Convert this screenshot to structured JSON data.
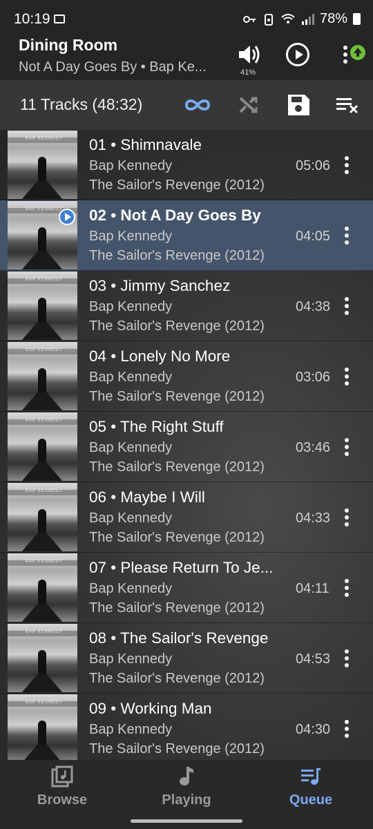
{
  "status_bar": {
    "time": "10:19",
    "battery": "78%"
  },
  "header": {
    "room": "Dining Room",
    "now_playing": "Not A Day Goes By • Bap Ke...",
    "volume_percent": "41%"
  },
  "toolbar": {
    "track_summary": "11 Tracks (48:32)"
  },
  "colors": {
    "accent": "#7aa9f0",
    "active_row": "#44546a",
    "badge": "#6fbf3a"
  },
  "tracks": [
    {
      "title": "01 • Shimnavale",
      "artist": "Bap Kennedy",
      "album": "The Sailor's Revenge (2012)",
      "duration": "05:06"
    },
    {
      "title": "02 • Not A Day Goes By",
      "artist": "Bap Kennedy",
      "album": "The Sailor's Revenge (2012)",
      "duration": "04:05"
    },
    {
      "title": "03 • Jimmy Sanchez",
      "artist": "Bap Kennedy",
      "album": "The Sailor's Revenge (2012)",
      "duration": "04:38"
    },
    {
      "title": "04 • Lonely No More",
      "artist": "Bap Kennedy",
      "album": "The Sailor's Revenge (2012)",
      "duration": "03:06"
    },
    {
      "title": "05 • The Right Stuff",
      "artist": "Bap Kennedy",
      "album": "The Sailor's Revenge (2012)",
      "duration": "03:46"
    },
    {
      "title": "06 • Maybe I Will",
      "artist": "Bap Kennedy",
      "album": "The Sailor's Revenge (2012)",
      "duration": "04:33"
    },
    {
      "title": "07 • Please Return To Je...",
      "artist": "Bap Kennedy",
      "album": "The Sailor's Revenge (2012)",
      "duration": "04:11"
    },
    {
      "title": "08 • The Sailor's Revenge",
      "artist": "Bap Kennedy",
      "album": "The Sailor's Revenge (2012)",
      "duration": "04:53"
    },
    {
      "title": "09 • Working Man",
      "artist": "Bap Kennedy",
      "album": "The Sailor's Revenge (2012)",
      "duration": "04:30"
    }
  ],
  "art_label": "BAP KENNEDY",
  "nav": {
    "browse": "Browse",
    "playing": "Playing",
    "queue": "Queue"
  }
}
